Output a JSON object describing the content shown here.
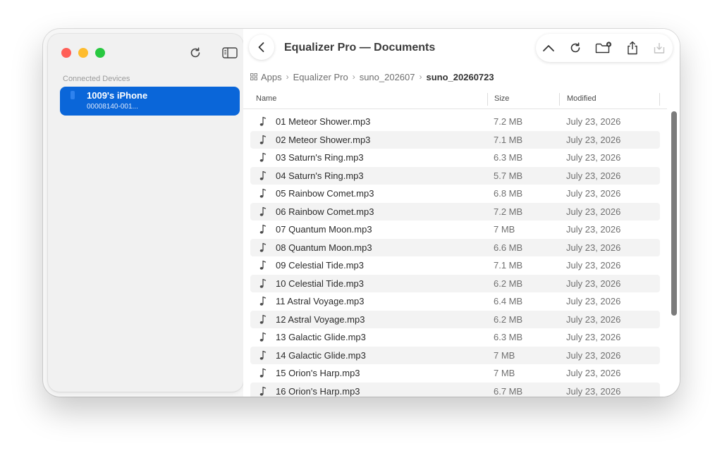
{
  "window": {
    "title": "Equalizer Pro — Documents"
  },
  "sidebar": {
    "section_title": "Connected Devices",
    "device": {
      "name": "1009's iPhone",
      "serial": "00008140-001..."
    }
  },
  "toolbar": {
    "icons": [
      "chevron-up-icon",
      "refresh-icon",
      "new-folder-icon",
      "share-icon",
      "download-icon"
    ]
  },
  "breadcrumb": {
    "items": [
      "Apps",
      "Equalizer Pro",
      "suno_202607",
      "suno_20260723"
    ]
  },
  "table": {
    "columns": [
      "Name",
      "Size",
      "Modified"
    ],
    "rows": [
      {
        "name": "01 Meteor Shower.mp3",
        "size": "7.2 MB",
        "modified": "July 23, 2026"
      },
      {
        "name": "02 Meteor Shower.mp3",
        "size": "7.1 MB",
        "modified": "July 23, 2026"
      },
      {
        "name": "03 Saturn's Ring.mp3",
        "size": "6.3 MB",
        "modified": "July 23, 2026"
      },
      {
        "name": "04 Saturn's Ring.mp3",
        "size": "5.7 MB",
        "modified": "July 23, 2026"
      },
      {
        "name": "05 Rainbow Comet.mp3",
        "size": "6.8 MB",
        "modified": "July 23, 2026"
      },
      {
        "name": "06 Rainbow Comet.mp3",
        "size": "7.2 MB",
        "modified": "July 23, 2026"
      },
      {
        "name": "07 Quantum Moon.mp3",
        "size": "7 MB",
        "modified": "July 23, 2026"
      },
      {
        "name": "08 Quantum Moon.mp3",
        "size": "6.6 MB",
        "modified": "July 23, 2026"
      },
      {
        "name": "09 Celestial Tide.mp3",
        "size": "7.1 MB",
        "modified": "July 23, 2026"
      },
      {
        "name": "10 Celestial Tide.mp3",
        "size": "6.2 MB",
        "modified": "July 23, 2026"
      },
      {
        "name": "11 Astral Voyage.mp3",
        "size": "6.4 MB",
        "modified": "July 23, 2026"
      },
      {
        "name": "12 Astral Voyage.mp3",
        "size": "6.2 MB",
        "modified": "July 23, 2026"
      },
      {
        "name": "13 Galactic Glide.mp3",
        "size": "6.3 MB",
        "modified": "July 23, 2026"
      },
      {
        "name": "14 Galactic Glide.mp3",
        "size": "7 MB",
        "modified": "July 23, 2026"
      },
      {
        "name": "15 Orion's Harp.mp3",
        "size": "7 MB",
        "modified": "July 23, 2026"
      },
      {
        "name": "16 Orion's Harp.mp3",
        "size": "6.7 MB",
        "modified": "July 23, 2026"
      }
    ]
  },
  "colors": {
    "accent": "#0a66d9",
    "close": "#ff5f57",
    "minimize": "#febc2e",
    "zoom": "#28c840"
  }
}
